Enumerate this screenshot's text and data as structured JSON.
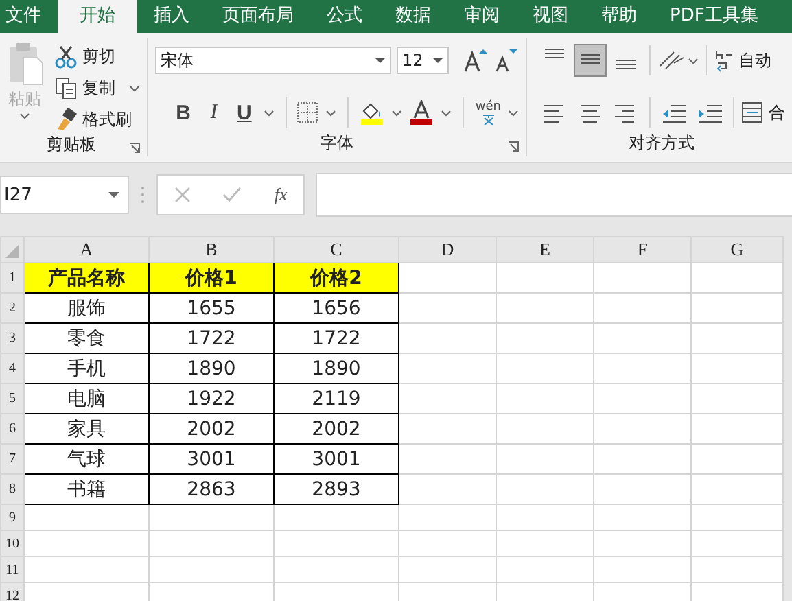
{
  "menu_tabs": [
    {
      "label": "文件",
      "selected": false
    },
    {
      "label": "开始",
      "selected": true
    },
    {
      "label": "插入",
      "selected": false
    },
    {
      "label": "页面布局",
      "selected": false
    },
    {
      "label": "公式",
      "selected": false
    },
    {
      "label": "数据",
      "selected": false
    },
    {
      "label": "审阅",
      "selected": false
    },
    {
      "label": "视图",
      "selected": false
    },
    {
      "label": "帮助",
      "selected": false
    },
    {
      "label": "PDF工具集",
      "selected": false
    }
  ],
  "ribbon": {
    "clipboard": {
      "paste": {
        "label": "粘贴",
        "disabled": true
      },
      "actions": [
        {
          "kind": "cut",
          "label": "剪切"
        },
        {
          "kind": "copy",
          "label": "复制"
        },
        {
          "kind": "brush",
          "label": "格式刷"
        }
      ],
      "group_label": "剪贴板"
    },
    "font": {
      "font_name": "宋体",
      "font_size": "12",
      "bold_label": "B",
      "italic_label": "I",
      "underline_label": "U",
      "phonetic_label": "wén",
      "group_label": "字体"
    },
    "alignment": {
      "vertical": [
        {
          "selected": false
        },
        {
          "selected": true
        },
        {
          "selected": false
        }
      ],
      "group_label": "对齐方式"
    },
    "wrap_text": "自动",
    "merge": "合"
  },
  "formula_bar": {
    "name_box": "I27",
    "function_label": "fx"
  },
  "sheet": {
    "columns": [
      "A",
      "B",
      "C",
      "D",
      "E",
      "F",
      "G"
    ],
    "rows": [
      {
        "number": "1",
        "highlighted": true,
        "cells": [
          "产品名称",
          "价格1",
          "价格2"
        ]
      },
      {
        "number": "2",
        "highlighted": false,
        "cells": [
          "服饰",
          "1655",
          "1656"
        ]
      },
      {
        "number": "3",
        "highlighted": false,
        "cells": [
          "零食",
          "1722",
          "1722"
        ]
      },
      {
        "number": "4",
        "highlighted": false,
        "cells": [
          "手机",
          "1890",
          "1890"
        ]
      },
      {
        "number": "5",
        "highlighted": false,
        "cells": [
          "电脑",
          "1922",
          "2119"
        ]
      },
      {
        "number": "6",
        "highlighted": false,
        "cells": [
          "家具",
          "2002",
          "2002"
        ]
      },
      {
        "number": "7",
        "highlighted": false,
        "cells": [
          "气球",
          "3001",
          "3001"
        ]
      },
      {
        "number": "8",
        "highlighted": false,
        "cells": [
          "书籍",
          "2863",
          "2893"
        ]
      },
      {
        "number": "9",
        "highlighted": false,
        "cells": []
      },
      {
        "number": "10",
        "highlighted": false,
        "cells": []
      },
      {
        "number": "11",
        "highlighted": false,
        "cells": []
      },
      {
        "number": "12",
        "highlighted": false,
        "cells": []
      }
    ]
  }
}
